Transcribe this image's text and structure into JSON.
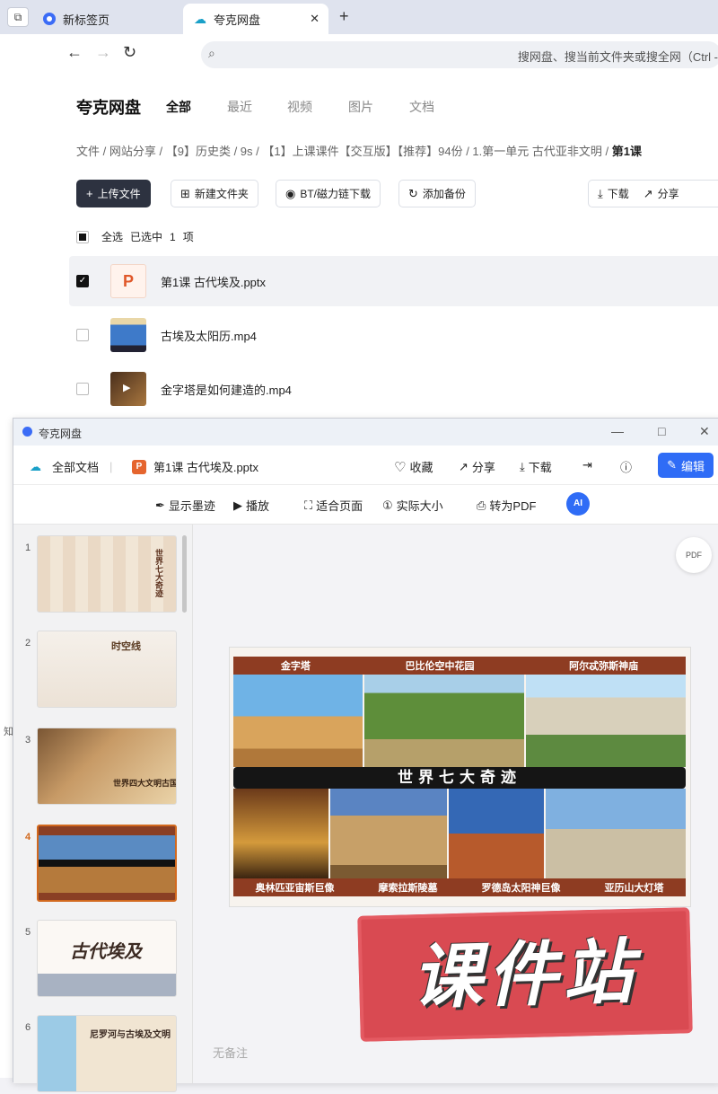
{
  "browser": {
    "tabs": [
      {
        "label": "新标签页"
      },
      {
        "label": "夸克网盘"
      }
    ],
    "address_placeholder": "搜网盘、搜当前文件夹或搜全网（Ctrl -"
  },
  "drive": {
    "brand": "夸克网盘",
    "nav": [
      "全部",
      "最近",
      "视频",
      "图片",
      "文档"
    ],
    "breadcrumb": [
      "文件",
      "网站分享",
      "【9】历史类",
      "9s",
      "【1】上课课件【交互版】【推荐】94份",
      "1.第一单元 古代亚非文明"
    ],
    "breadcrumb_current": "第1课",
    "actions": {
      "upload": "上传文件",
      "new_folder": "新建文件夹",
      "bt": "BT/磁力链下载",
      "backup": "添加备份",
      "download": "下载",
      "share": "分享"
    },
    "selection": {
      "all": "全选",
      "selected_label": "已选中",
      "count": "1",
      "unit": "项"
    },
    "files": [
      {
        "name": "第1课 古代埃及.pptx",
        "thumb": "P"
      },
      {
        "name": "古埃及太阳历.mp4"
      },
      {
        "name": "金字塔是如何建造的.mp4"
      }
    ]
  },
  "viewer": {
    "window_title": "夸克网盘",
    "all_docs": "全部文档",
    "file_title": "第1课 古代埃及.pptx",
    "file_badge": "P",
    "header_actions": {
      "favorite": "收藏",
      "share": "分享",
      "download": "下载",
      "edit": "编辑"
    },
    "toolbar": {
      "ink": "显示墨迹",
      "play": "播放",
      "fit": "适合页面",
      "actual": "实际大小",
      "to_pdf": "转为PDF",
      "ai": "AI",
      "pdf_icon": "PDF"
    },
    "slides": [
      "1",
      "2",
      "3",
      "4",
      "5",
      "6"
    ],
    "current_slide": "4",
    "thumb_labels": {
      "s1": "世界七大奇迹",
      "s2": "时空线",
      "s3": "世界四大文明古国",
      "s5": "古代埃及",
      "s6": "尼罗河与古埃及文明"
    },
    "no_notes": "无备注",
    "slide4": {
      "top_captions": [
        "金字塔",
        "巴比伦空中花园",
        "阿尔忒弥斯神庙"
      ],
      "banner": "世界七大奇迹",
      "bottom_captions": [
        "奥林匹亚宙斯巨像",
        "摩索拉斯陵墓",
        "罗德岛太阳神巨像",
        "亚历山大灯塔"
      ]
    }
  },
  "watermark": "课件站",
  "edge_text": "知"
}
